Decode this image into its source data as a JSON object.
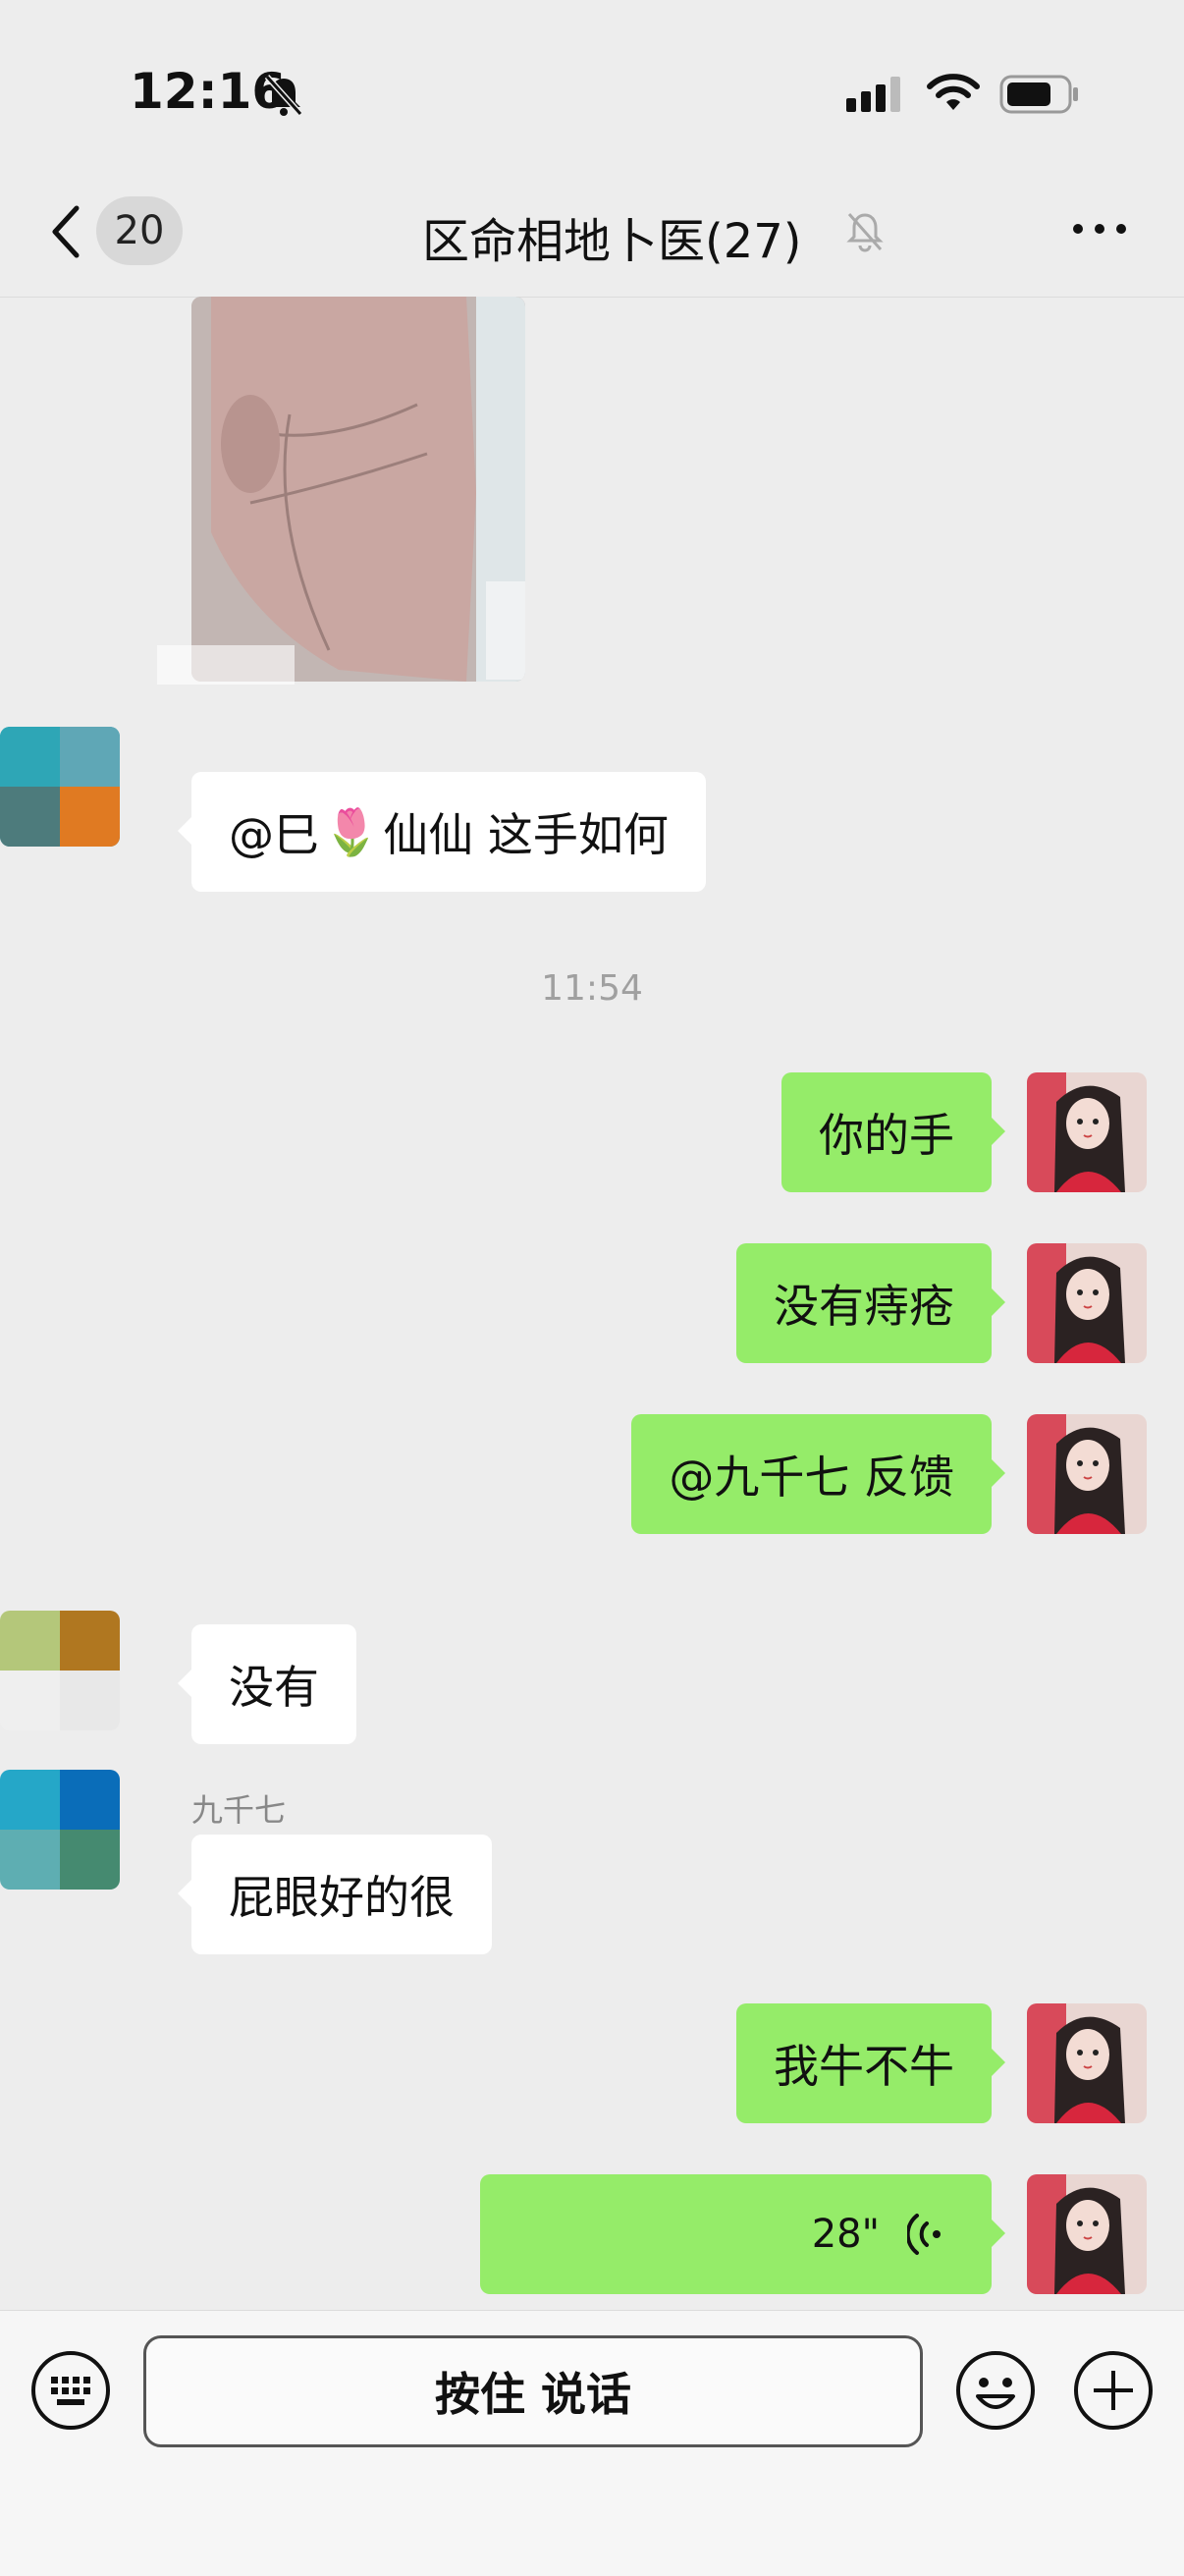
{
  "status_bar": {
    "time": "12:16"
  },
  "header": {
    "unread_count": "20",
    "title": "区命相地卜医(27)"
  },
  "messages": [
    {
      "type": "image",
      "direction": "in",
      "description": "palm photo"
    },
    {
      "type": "text",
      "direction": "in",
      "sender": "",
      "text_before": "@巳",
      "emoji": "🌷",
      "text_after": "仙仙 这手如何"
    },
    {
      "type": "timestamp",
      "text": "11:54"
    },
    {
      "type": "text",
      "direction": "out",
      "text": "你的手"
    },
    {
      "type": "text",
      "direction": "out",
      "text": "没有痔疮"
    },
    {
      "type": "text",
      "direction": "out",
      "text": "@九千七 反馈"
    },
    {
      "type": "text",
      "direction": "in",
      "text": "没有"
    },
    {
      "type": "text",
      "direction": "in",
      "sender": "九千七",
      "text": "屁眼好的很"
    },
    {
      "type": "text",
      "direction": "out",
      "text": "我牛不牛"
    },
    {
      "type": "voice",
      "direction": "out",
      "duration": "28\""
    }
  ],
  "input_bar": {
    "hold_to_talk_label": "按住 说话"
  },
  "colors": {
    "background": "#ededed",
    "outgoing_bubble": "#95ec69",
    "incoming_bubble": "#ffffff"
  },
  "icons": [
    "bell-off-icon",
    "signal-icon",
    "wifi-icon",
    "battery-icon",
    "back-icon",
    "mute-icon",
    "more-icon",
    "voice-wave-icon",
    "keyboard-icon",
    "emoji-icon",
    "plus-icon"
  ]
}
